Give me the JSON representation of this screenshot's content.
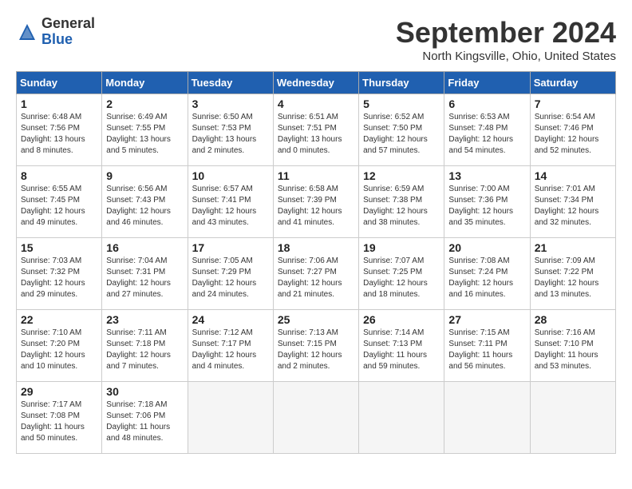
{
  "logo": {
    "general": "General",
    "blue": "Blue"
  },
  "title": "September 2024",
  "subtitle": "North Kingsville, Ohio, United States",
  "days_header": [
    "Sunday",
    "Monday",
    "Tuesday",
    "Wednesday",
    "Thursday",
    "Friday",
    "Saturday"
  ],
  "weeks": [
    [
      {
        "day": "1",
        "sunrise": "6:48 AM",
        "sunset": "7:56 PM",
        "daylight": "13 hours and 8 minutes."
      },
      {
        "day": "2",
        "sunrise": "6:49 AM",
        "sunset": "7:55 PM",
        "daylight": "13 hours and 5 minutes."
      },
      {
        "day": "3",
        "sunrise": "6:50 AM",
        "sunset": "7:53 PM",
        "daylight": "13 hours and 2 minutes."
      },
      {
        "day": "4",
        "sunrise": "6:51 AM",
        "sunset": "7:51 PM",
        "daylight": "13 hours and 0 minutes."
      },
      {
        "day": "5",
        "sunrise": "6:52 AM",
        "sunset": "7:50 PM",
        "daylight": "12 hours and 57 minutes."
      },
      {
        "day": "6",
        "sunrise": "6:53 AM",
        "sunset": "7:48 PM",
        "daylight": "12 hours and 54 minutes."
      },
      {
        "day": "7",
        "sunrise": "6:54 AM",
        "sunset": "7:46 PM",
        "daylight": "12 hours and 52 minutes."
      }
    ],
    [
      {
        "day": "8",
        "sunrise": "6:55 AM",
        "sunset": "7:45 PM",
        "daylight": "12 hours and 49 minutes."
      },
      {
        "day": "9",
        "sunrise": "6:56 AM",
        "sunset": "7:43 PM",
        "daylight": "12 hours and 46 minutes."
      },
      {
        "day": "10",
        "sunrise": "6:57 AM",
        "sunset": "7:41 PM",
        "daylight": "12 hours and 43 minutes."
      },
      {
        "day": "11",
        "sunrise": "6:58 AM",
        "sunset": "7:39 PM",
        "daylight": "12 hours and 41 minutes."
      },
      {
        "day": "12",
        "sunrise": "6:59 AM",
        "sunset": "7:38 PM",
        "daylight": "12 hours and 38 minutes."
      },
      {
        "day": "13",
        "sunrise": "7:00 AM",
        "sunset": "7:36 PM",
        "daylight": "12 hours and 35 minutes."
      },
      {
        "day": "14",
        "sunrise": "7:01 AM",
        "sunset": "7:34 PM",
        "daylight": "12 hours and 32 minutes."
      }
    ],
    [
      {
        "day": "15",
        "sunrise": "7:03 AM",
        "sunset": "7:32 PM",
        "daylight": "12 hours and 29 minutes."
      },
      {
        "day": "16",
        "sunrise": "7:04 AM",
        "sunset": "7:31 PM",
        "daylight": "12 hours and 27 minutes."
      },
      {
        "day": "17",
        "sunrise": "7:05 AM",
        "sunset": "7:29 PM",
        "daylight": "12 hours and 24 minutes."
      },
      {
        "day": "18",
        "sunrise": "7:06 AM",
        "sunset": "7:27 PM",
        "daylight": "12 hours and 21 minutes."
      },
      {
        "day": "19",
        "sunrise": "7:07 AM",
        "sunset": "7:25 PM",
        "daylight": "12 hours and 18 minutes."
      },
      {
        "day": "20",
        "sunrise": "7:08 AM",
        "sunset": "7:24 PM",
        "daylight": "12 hours and 16 minutes."
      },
      {
        "day": "21",
        "sunrise": "7:09 AM",
        "sunset": "7:22 PM",
        "daylight": "12 hours and 13 minutes."
      }
    ],
    [
      {
        "day": "22",
        "sunrise": "7:10 AM",
        "sunset": "7:20 PM",
        "daylight": "12 hours and 10 minutes."
      },
      {
        "day": "23",
        "sunrise": "7:11 AM",
        "sunset": "7:18 PM",
        "daylight": "12 hours and 7 minutes."
      },
      {
        "day": "24",
        "sunrise": "7:12 AM",
        "sunset": "7:17 PM",
        "daylight": "12 hours and 4 minutes."
      },
      {
        "day": "25",
        "sunrise": "7:13 AM",
        "sunset": "7:15 PM",
        "daylight": "12 hours and 2 minutes."
      },
      {
        "day": "26",
        "sunrise": "7:14 AM",
        "sunset": "7:13 PM",
        "daylight": "11 hours and 59 minutes."
      },
      {
        "day": "27",
        "sunrise": "7:15 AM",
        "sunset": "7:11 PM",
        "daylight": "11 hours and 56 minutes."
      },
      {
        "day": "28",
        "sunrise": "7:16 AM",
        "sunset": "7:10 PM",
        "daylight": "11 hours and 53 minutes."
      }
    ],
    [
      {
        "day": "29",
        "sunrise": "7:17 AM",
        "sunset": "7:08 PM",
        "daylight": "11 hours and 50 minutes."
      },
      {
        "day": "30",
        "sunrise": "7:18 AM",
        "sunset": "7:06 PM",
        "daylight": "11 hours and 48 minutes."
      },
      null,
      null,
      null,
      null,
      null
    ]
  ],
  "labels": {
    "sunrise": "Sunrise: ",
    "sunset": "Sunset: ",
    "daylight": "Daylight: "
  }
}
